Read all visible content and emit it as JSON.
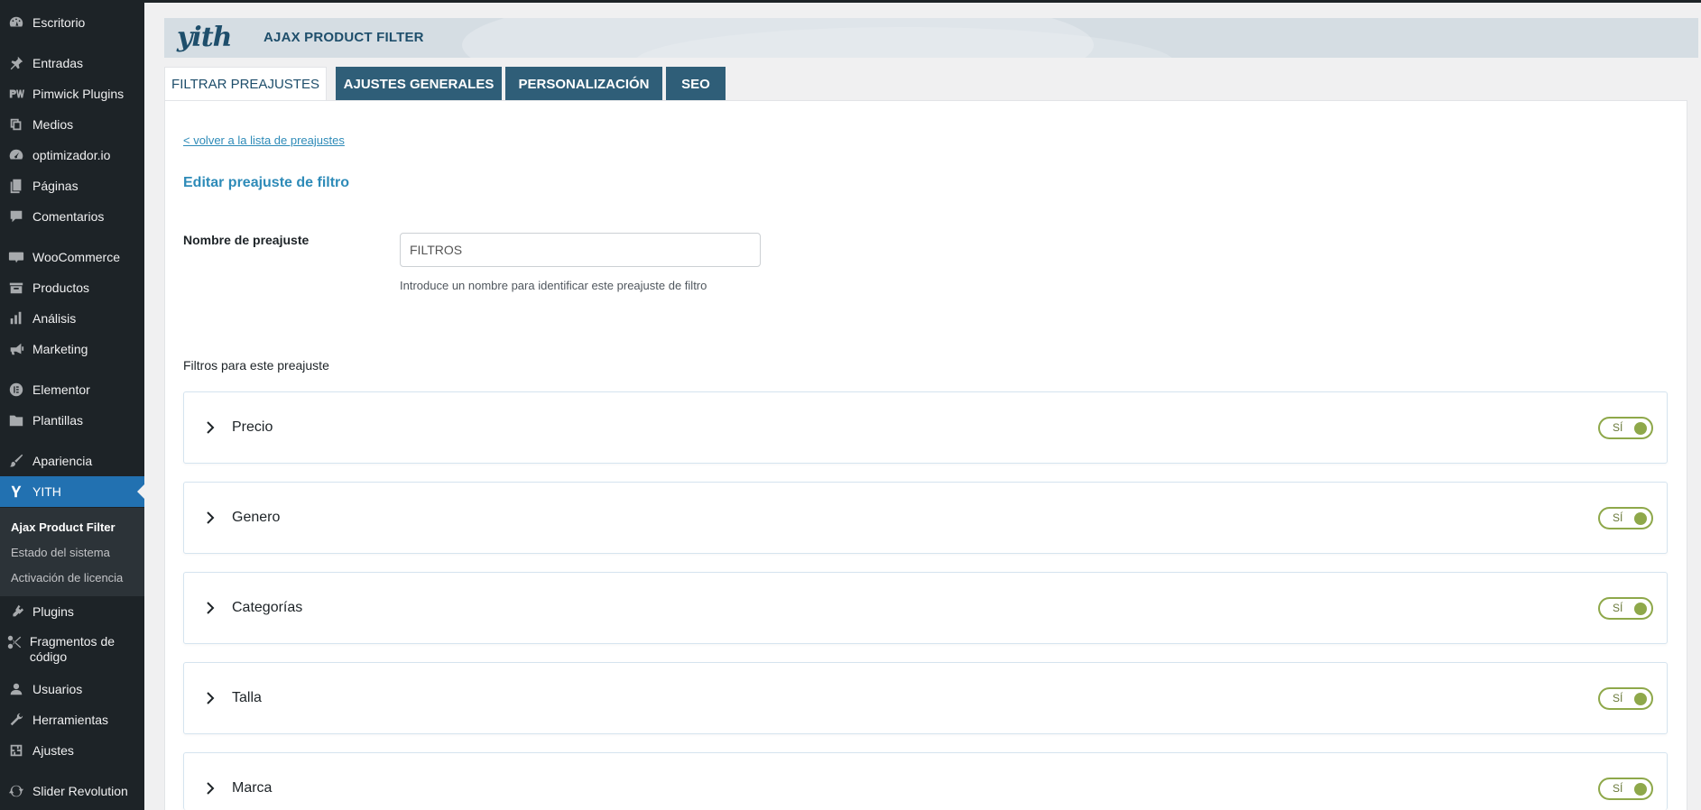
{
  "sidebar": {
    "items": [
      {
        "label": "Escritorio",
        "icon": "dashboard-icon"
      },
      {
        "label": "Entradas",
        "icon": "pin-icon"
      },
      {
        "label": "Pimwick Plugins",
        "icon": "pimwick-icon"
      },
      {
        "label": "Medios",
        "icon": "media-icon"
      },
      {
        "label": "optimizador.io",
        "icon": "gauge-icon"
      },
      {
        "label": "Páginas",
        "icon": "pages-icon"
      },
      {
        "label": "Comentarios",
        "icon": "comments-icon"
      },
      {
        "label": "WooCommerce",
        "icon": "woo-icon"
      },
      {
        "label": "Productos",
        "icon": "products-icon"
      },
      {
        "label": "Análisis",
        "icon": "analytics-icon"
      },
      {
        "label": "Marketing",
        "icon": "megaphone-icon"
      },
      {
        "label": "Elementor",
        "icon": "elementor-icon"
      },
      {
        "label": "Plantillas",
        "icon": "folder-icon"
      },
      {
        "label": "Apariencia",
        "icon": "brush-icon"
      },
      {
        "label": "YITH",
        "icon": "yith-icon"
      },
      {
        "label": "Plugins",
        "icon": "plugins-icon"
      },
      {
        "label": "Fragmentos de código",
        "icon": "scissors-icon"
      },
      {
        "label": "Usuarios",
        "icon": "users-icon"
      },
      {
        "label": "Herramientas",
        "icon": "wrench-icon"
      },
      {
        "label": "Ajustes",
        "icon": "settings-icon"
      },
      {
        "label": "Slider Revolution",
        "icon": "refresh-icon"
      }
    ],
    "submenu": [
      {
        "label": "Ajax Product Filter"
      },
      {
        "label": "Estado del sistema"
      },
      {
        "label": "Activación de licencia"
      }
    ]
  },
  "header": {
    "logo": "yith",
    "title": "AJAX PRODUCT FILTER"
  },
  "tabs": [
    {
      "label": "FILTRAR PREAJUSTES",
      "active": true
    },
    {
      "label": "AJUSTES GENERALES",
      "active": false
    },
    {
      "label": "PERSONALIZACIÓN",
      "active": false
    },
    {
      "label": "SEO",
      "active": false
    }
  ],
  "form": {
    "back_link": "< volver a la lista de preajustes",
    "edit_title": "Editar preajuste de filtro",
    "name_label": "Nombre de preajuste",
    "name_value": "FILTROS",
    "name_help": "Introduce un nombre para identificar este preajuste de filtro",
    "filters_title": "Filtros para este preajuste"
  },
  "filters": [
    {
      "name": "Precio",
      "toggle": "SÍ"
    },
    {
      "name": "Genero",
      "toggle": "SÍ"
    },
    {
      "name": "Categorías",
      "toggle": "SÍ"
    },
    {
      "name": "Talla",
      "toggle": "SÍ"
    },
    {
      "name": "Marca",
      "toggle": "SÍ"
    }
  ],
  "colors": {
    "sidebar_bg": "#1d2327",
    "active_menu": "#2271b1",
    "tab_inactive": "#2f5e78",
    "link": "#2e8bb8",
    "toggle_green": "#8ea84a"
  }
}
